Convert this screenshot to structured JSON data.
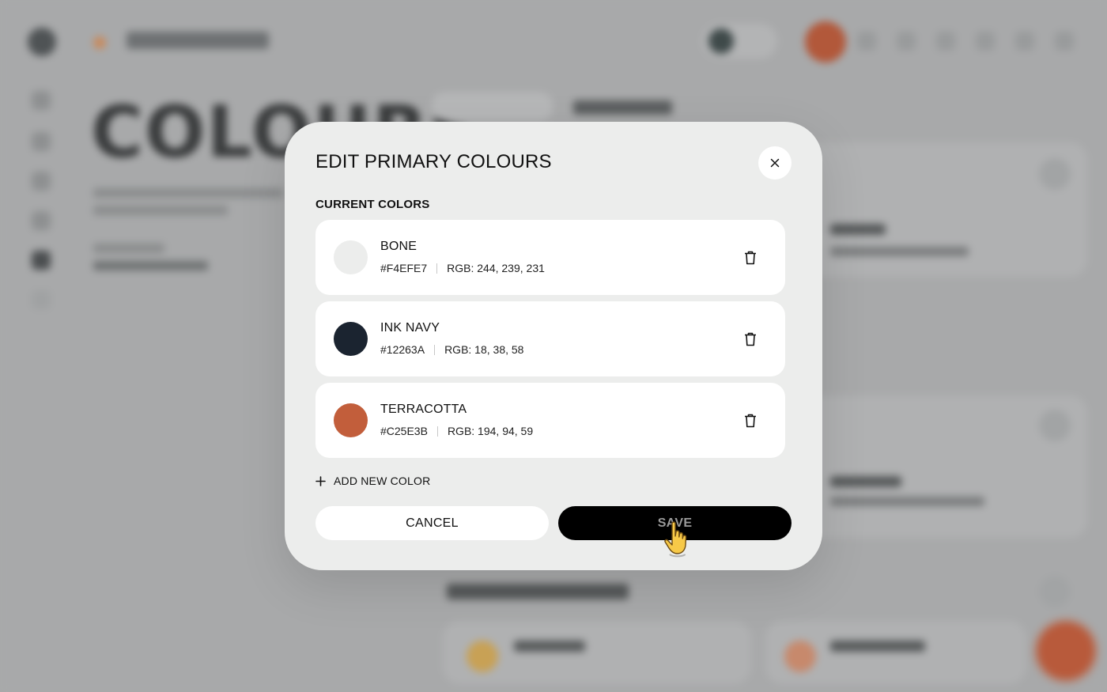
{
  "background": {
    "headline": "COLOURS"
  },
  "modal": {
    "title": "EDIT PRIMARY COLOURS",
    "close_icon": "close-icon",
    "section_label": "CURRENT COLORS",
    "colors": [
      {
        "name": "BONE",
        "hex": "#F4EFE7",
        "rgb": "RGB: 244, 239, 231",
        "swatch": "#ECEDEC"
      },
      {
        "name": "INK NAVY",
        "hex": "#12263A",
        "rgb": "RGB: 18, 38, 58",
        "swatch": "#1B2430"
      },
      {
        "name": "TERRACOTTA",
        "hex": "#C25E3B",
        "rgb": "RGB: 194, 94, 59",
        "swatch": "#C25E3B"
      }
    ],
    "add_label": "ADD NEW COLOR",
    "cancel_label": "CANCEL",
    "save_label": "SAVE"
  }
}
